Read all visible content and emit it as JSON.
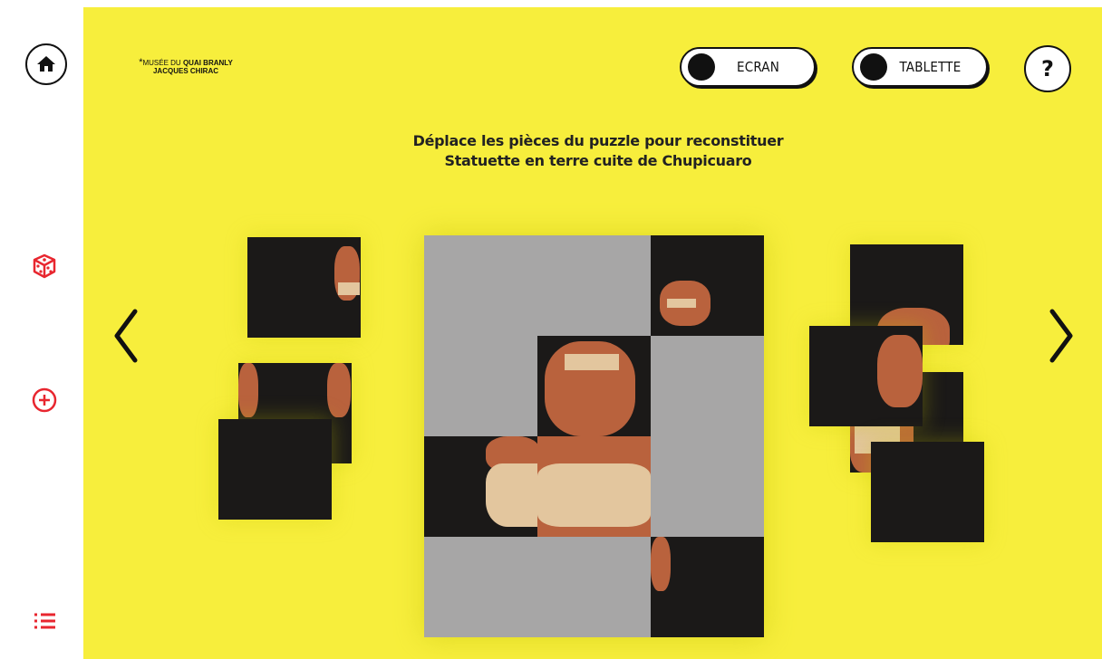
{
  "logo": {
    "line1_prefix": "MUSÉE DU",
    "line1_bold": "QUAI BRANLY",
    "line2": "JACQUES CHIRAC"
  },
  "toggles": {
    "screen_label": "ECRAN",
    "tablet_label": "TABLETTE"
  },
  "help_label": "?",
  "instructions": {
    "line1": "Déplace les pièces du puzzle pour reconstituer",
    "line2": "Statuette en terre cuite de Chupicuaro"
  },
  "icons": {
    "home": "home-icon",
    "dice": "dice-icon",
    "add": "plus-circle-icon",
    "menu": "list-icon",
    "prev": "chevron-left-icon",
    "next": "chevron-right-icon"
  },
  "colors": {
    "stage_background": "#f7ee3c",
    "accent_red": "#e8262f",
    "placeholder_grey": "#a7a6a6",
    "piece_dark": "#1b1918"
  }
}
